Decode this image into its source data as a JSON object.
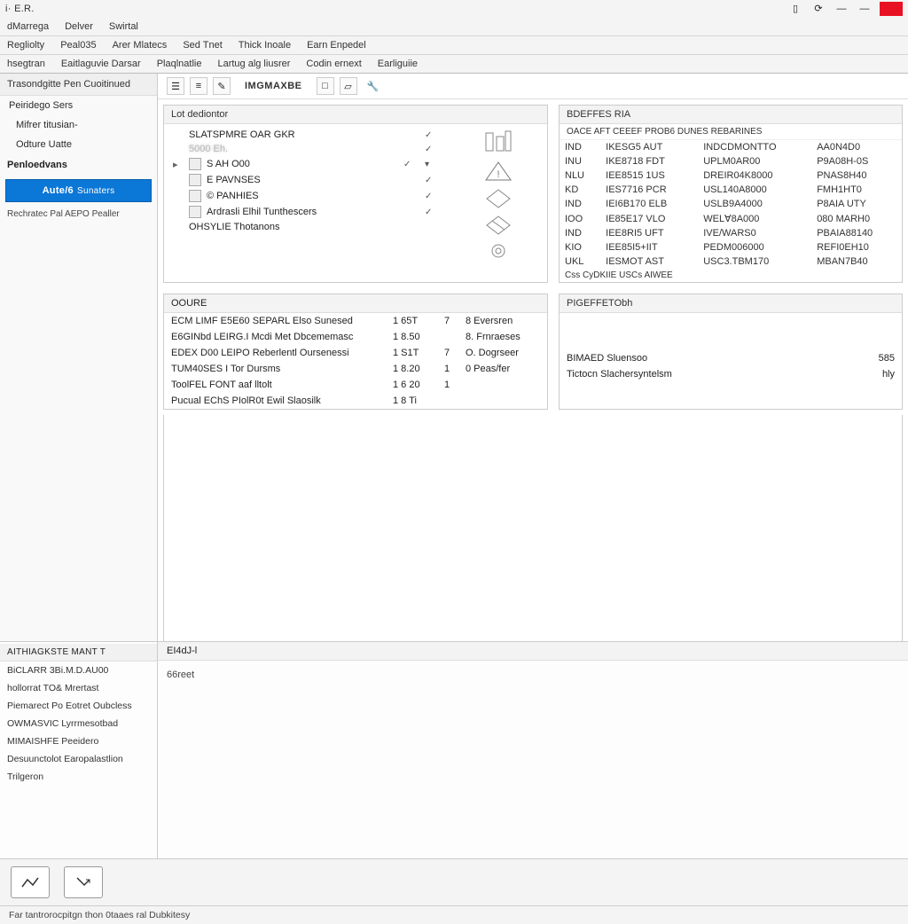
{
  "title": "i· E.R.",
  "menubar1": [
    "dMarrega",
    "Delver",
    "Swirtal"
  ],
  "menubar2": [
    "Regliolty",
    "Peal035",
    "Arer Mlatecs",
    "Sed Tnet",
    "Thick Inoale",
    "Earn Enpedel"
  ],
  "menubar3": [
    "hsegtran",
    "Eaitlaguvie Darsar",
    "Plaqlnatlie",
    "Lartug alg liusrer",
    "Codin ernext",
    "Earliguiie"
  ],
  "sidebar": {
    "tab": "Trasondgitte Pen Cuoitinued",
    "link1": "Peiridego Sers",
    "link2": "Mifrer titusian-",
    "link3": "Odture Uatte",
    "section": "Penloedvans",
    "brand_main": "Aute/6",
    "brand_sub": "Sunaters",
    "caption": "Rechratec Pal AEPO Pealler"
  },
  "toolbar": {
    "label": "IMGMAXBE"
  },
  "tree": {
    "header": "Lot dediontor",
    "rows": [
      {
        "label": "SLATSPMRE OAR GKR",
        "tick": "✓"
      },
      {
        "label": "5000 Eh.",
        "tick": "✓",
        "blurry": true
      },
      {
        "label": "S AH O00",
        "tick": "✓",
        "sub": true
      },
      {
        "label": "E PAVNSES",
        "tick": "✓",
        "sub": true
      },
      {
        "label": "© PANHIES",
        "tick": "✓",
        "sub": true
      },
      {
        "label": "Ardrasli Elhil Tunthescers",
        "tick": "✓",
        "sub": true
      },
      {
        "label": "OHSYLIE Thotanons",
        "tick": "",
        "sub": true
      }
    ]
  },
  "right_panel": {
    "header": "BDEFFES RIA",
    "sub": "OACE AFT CEEEF PROB6 DUNES REBARINES",
    "rows": [
      [
        "IND",
        "IKESG5 AUT",
        "INDCDMONTTO",
        "AA0N4D0"
      ],
      [
        "INU",
        "IKE8718 FDT",
        "UPLM0AR00",
        "P9A08H-0S"
      ],
      [
        "NLU",
        "IEE8515 1US",
        "DREIR04K8000",
        "PNAS8H40"
      ],
      [
        "KD",
        "IES7716 PCR",
        "USL140A8000",
        "FMH1HT0"
      ],
      [
        "IND",
        "IEI6B170 ELB",
        "USLB9A4000",
        "P8AIA UTY"
      ],
      [
        "IOO",
        "IE85E17 VLO",
        "WEL∀8A000",
        "080 MARH0"
      ],
      [
        "IND",
        "IEE8RI5 UFT",
        "IVE/WARS0",
        "PBAIA88140"
      ],
      [
        "KIO",
        "IEE85I5+IIT",
        "PEDM006000",
        "REFI0EH10"
      ],
      [
        "UKL",
        "IESMOT AST",
        "USC3.TBM170",
        "MBAN7B40"
      ]
    ],
    "trail": "Css CyDKIIE USCs AIWEE"
  },
  "grid": {
    "header": "OOURE",
    "rows": [
      {
        "c1": "ECM LIMF E5E60 SEPARL Elso Sunesed",
        "c2": "1 65T",
        "c3": "7",
        "c4": "8 Eversren"
      },
      {
        "c1": "E6GINbd LEIRG.I Mcdi Met Dbcememasc",
        "c2": "1 8.50",
        "c3": "",
        "c4": "8. Frnraeses"
      },
      {
        "c1": "EDEX D00 LEIPO Reberlentl Oursenessi",
        "c2": "1 S1T",
        "c3": "7",
        "c4": "O. Dogrseer"
      },
      {
        "c1": "TUM40SES I Tor Dursms",
        "c2": "1 8.20",
        "c3": "1",
        "c4": "0 Peas/fer"
      },
      {
        "c1": "ToolFEL FONT aaf lltolt",
        "c2": "1 6 20",
        "c3": "1",
        "c4": ""
      },
      {
        "c1": "Pucual EChS PIolR0t Ewil Slaosilk",
        "c2": "1 8 Ti",
        "c3": "",
        "c4": ""
      }
    ]
  },
  "props": {
    "header": "PIGEFFETObh",
    "rows": [
      {
        "k": "BIMAED Sluensoo",
        "v": "585"
      },
      {
        "k": "Tictocn Slachersyntelsm",
        "v": "hly"
      }
    ]
  },
  "lower_left": {
    "header": "AITHIAGKSTE MANT T",
    "items": [
      "BiCLARR 3Bi.M.D.AU00",
      "hollorrat TO& Mrertast",
      "Piemarect Po Eotret Oubcless",
      "OWMASVIC Lyrrmesotbad",
      "MIMAISHFE Peeidero",
      "Desuunctolot Earopalastlion",
      "Trilgeron"
    ]
  },
  "lower_right": {
    "tab": "EI4dJ-l",
    "body": "66reet"
  },
  "statusbar": "Far tantrorocpitgn thon 0taaes ral Dubkitesy"
}
